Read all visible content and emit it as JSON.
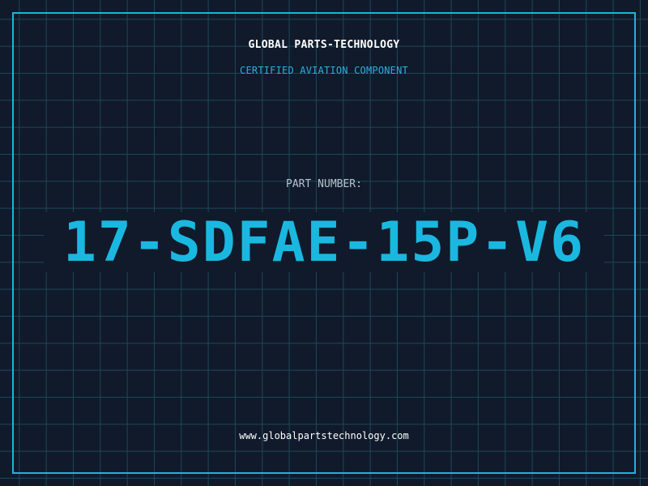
{
  "label": {
    "company": "GLOBAL PARTS-TECHNOLOGY",
    "certification": "CERTIFIED AVIATION COMPONENT",
    "part_number_caption": "PART NUMBER:",
    "part_number": "17-SDFAE-15P-V6",
    "website": "www.globalpartstechnology.com"
  },
  "colors": {
    "background": "#101a2b",
    "grid": "#1d4858",
    "accent": "#1eb4dc",
    "part_number": "#1ab8e0",
    "text_primary": "#ffffff",
    "text_muted": "#b8c2cc"
  }
}
